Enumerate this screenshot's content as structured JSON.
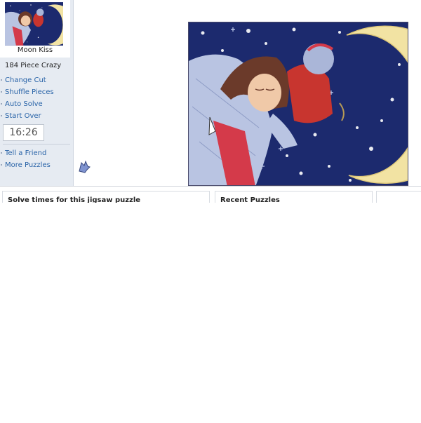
{
  "puzzle": {
    "title": "Moon Kiss",
    "piece_info": "184 Piece Crazy"
  },
  "menu": {
    "items": [
      {
        "label": "Change Cut"
      },
      {
        "label": "Shuffle Pieces"
      },
      {
        "label": "Auto Solve"
      },
      {
        "label": "Start Over"
      }
    ]
  },
  "timer": "16:26",
  "menu2": {
    "items": [
      {
        "label": "Tell a Friend"
      },
      {
        "label": "More Puzzles"
      }
    ]
  },
  "panels": {
    "solve_times_title": "Solve times for this jigsaw puzzle",
    "recent_title": "Recent Puzzles"
  },
  "colors": {
    "link": "#2a64a8",
    "sidebar_bg": "#e6ebf2",
    "night_sky": "#1c2a6e",
    "moon": "#f2e3a3"
  }
}
